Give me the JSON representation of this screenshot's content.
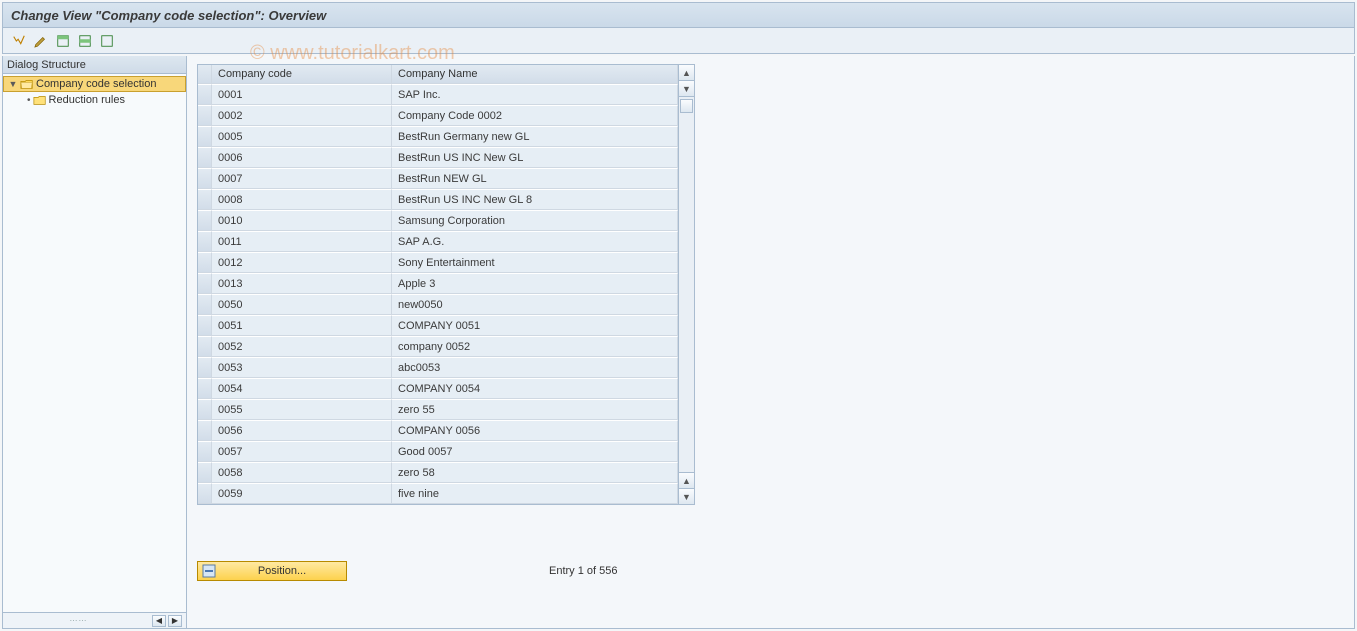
{
  "title": "Change View \"Company code selection\": Overview",
  "watermark": "© www.tutorialkart.com",
  "toolbar": {
    "icons": [
      "display-change",
      "other-object",
      "select-all",
      "select-block",
      "deselect-all"
    ]
  },
  "sidebar": {
    "header": "Dialog Structure",
    "items": [
      {
        "label": "Company code selection",
        "selected": true,
        "open": true
      },
      {
        "label": "Reduction rules",
        "selected": false,
        "open": false
      }
    ]
  },
  "table": {
    "headers": {
      "code": "Company code",
      "name": "Company Name"
    },
    "rows": [
      {
        "code": "0001",
        "name": "SAP Inc."
      },
      {
        "code": "0002",
        "name": "Company Code 0002"
      },
      {
        "code": "0005",
        "name": "BestRun Germany new GL"
      },
      {
        "code": "0006",
        "name": "BestRun US INC New GL"
      },
      {
        "code": "0007",
        "name": "BestRun NEW GL"
      },
      {
        "code": "0008",
        "name": "BestRun US INC New GL 8"
      },
      {
        "code": "0010",
        "name": "Samsung Corporation"
      },
      {
        "code": "0011",
        "name": "SAP A.G."
      },
      {
        "code": "0012",
        "name": "Sony Entertainment"
      },
      {
        "code": "0013",
        "name": "Apple 3"
      },
      {
        "code": "0050",
        "name": "new0050"
      },
      {
        "code": "0051",
        "name": "COMPANY 0051"
      },
      {
        "code": "0052",
        "name": "company 0052"
      },
      {
        "code": "0053",
        "name": "abc0053"
      },
      {
        "code": "0054",
        "name": "COMPANY 0054"
      },
      {
        "code": "0055",
        "name": "zero 55"
      },
      {
        "code": "0056",
        "name": "COMPANY 0056"
      },
      {
        "code": "0057",
        "name": "Good 0057"
      },
      {
        "code": "0058",
        "name": "zero 58"
      },
      {
        "code": "0059",
        "name": "five nine"
      }
    ]
  },
  "footer": {
    "position_label": "Position...",
    "status": "Entry 1 of 556"
  }
}
